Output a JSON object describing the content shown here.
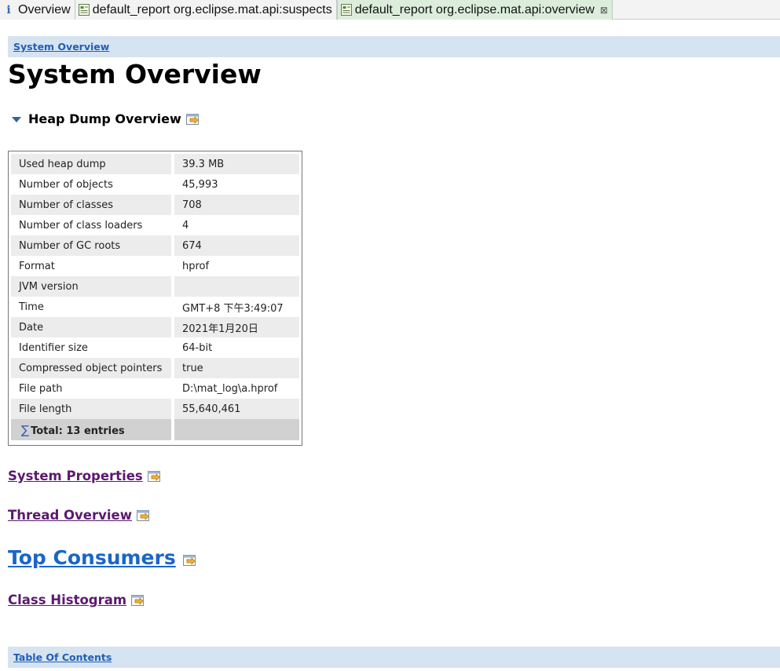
{
  "tabs": [
    {
      "label": "Overview",
      "icon": "info-icon",
      "active": false
    },
    {
      "label": "default_report  org.eclipse.mat.api:suspects",
      "icon": "report-icon",
      "active": false
    },
    {
      "label": "default_report  org.eclipse.mat.api:overview",
      "icon": "report-icon",
      "active": true,
      "close": "⊠"
    }
  ],
  "breadcrumb": {
    "label": "System Overview"
  },
  "page_title": "System Overview",
  "heap_section": {
    "title": "Heap Dump Overview"
  },
  "heap_table": {
    "rows": [
      {
        "key": "Used heap dump",
        "value": "39.3 MB"
      },
      {
        "key": "Number of objects",
        "value": "45,993"
      },
      {
        "key": "Number of classes",
        "value": "708"
      },
      {
        "key": "Number of class loaders",
        "value": "4"
      },
      {
        "key": "Number of GC roots",
        "value": "674"
      },
      {
        "key": "Format",
        "value": "hprof"
      },
      {
        "key": "JVM version",
        "value": ""
      },
      {
        "key": "Time",
        "value": "GMT+8 下午3:49:07"
      },
      {
        "key": "Date",
        "value": "2021年1月20日"
      },
      {
        "key": "Identifier size",
        "value": "64-bit"
      },
      {
        "key": "Compressed object pointers",
        "value": "true"
      },
      {
        "key": "File path",
        "value": "D:\\mat_log\\a.hprof"
      },
      {
        "key": "File length",
        "value": "55,640,461"
      }
    ],
    "total": {
      "sigma": "∑",
      "label": "Total: 13 entries"
    }
  },
  "sections": {
    "system_properties": "System Properties",
    "thread_overview": "Thread Overview",
    "top_consumers": "Top Consumers",
    "class_histogram": "Class Histogram"
  },
  "footer_breadcrumb": {
    "label": "Table Of Contents"
  },
  "colors": {
    "breadcrumb_bg": "#d6e3f1",
    "link_blue": "#1a66c8",
    "link_visited": "#5b1a6e",
    "active_tab_bg": "#dceddc"
  }
}
